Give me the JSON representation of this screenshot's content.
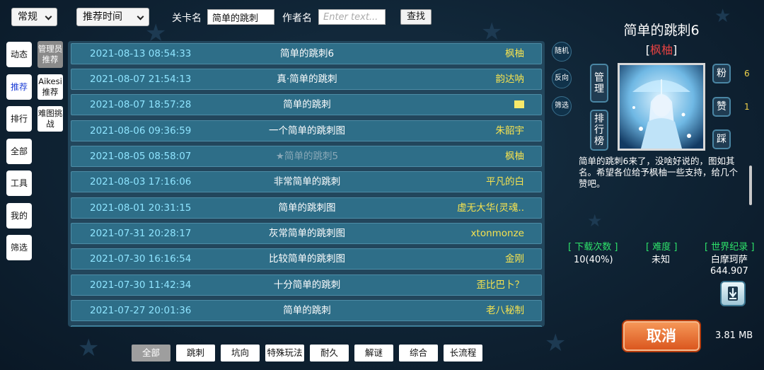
{
  "filters": {
    "mode": "常规",
    "sort": "推荐时间",
    "level_label": "关卡名",
    "level_value": "简单的跳刺",
    "author_label": "作者名",
    "author_placeholder": "Enter text...",
    "search_label": "查找"
  },
  "sidebar": {
    "primary": [
      "动态",
      "推荐",
      "排行",
      "全部",
      "工具",
      "我的",
      "筛选"
    ],
    "secondary": [
      "管理员推荐",
      "Aikesi推荐",
      "难图挑战"
    ]
  },
  "rows": [
    {
      "date": "2021-08-13 08:54:33",
      "name": "简单的跳刺6",
      "author": "枫柚"
    },
    {
      "date": "2021-08-07 21:54:13",
      "name": "真·简单的跳刺",
      "author": "韵达呐"
    },
    {
      "date": "2021-08-07 18:57:28",
      "name": "简单的跳刺",
      "author": ""
    },
    {
      "date": "2021-08-06 09:36:59",
      "name": "一个简单的跳刺图",
      "author": "朱韶宇"
    },
    {
      "date": "2021-08-05 08:58:07",
      "name": "★简单的跳刺5",
      "author": "枫柚"
    },
    {
      "date": "2021-08-03 17:16:06",
      "name": "非常简单的跳刺",
      "author": "平凡的白"
    },
    {
      "date": "2021-08-01 20:31:15",
      "name": "简单的跳刺图",
      "author": "虚无大华(灵魂.."
    },
    {
      "date": "2021-07-31 20:28:17",
      "name": "灰常简单的跳刺图",
      "author": "xtonmonze"
    },
    {
      "date": "2021-07-30 16:16:54",
      "name": "比较简单的跳刺图",
      "author": "金刚"
    },
    {
      "date": "2021-07-30 11:42:34",
      "name": "十分简单的跳刺",
      "author": "歪比巴卜？"
    },
    {
      "date": "2021-07-27 20:01:36",
      "name": "简单的跳刺",
      "author": "老八秘制"
    }
  ],
  "side_actions": [
    "随机",
    "反向",
    "筛选"
  ],
  "categories": [
    "全部",
    "跳刺",
    "坑向",
    "特殊玩法",
    "耐久",
    "解谜",
    "综合",
    "长流程"
  ],
  "detail": {
    "title": "简单的跳刺6",
    "author": "枫柚",
    "buttons": {
      "manage": "管理",
      "ranking": "排行榜",
      "fans": "粉",
      "like": "赞",
      "dislike": "踩"
    },
    "fans_count": "6",
    "like_count": "1",
    "description": "简单的跳刺6来了，没啥好说的，图如其名。希望各位给予枫柚一些支持，给几个赞吧。",
    "downloads_label": "[ 下载次数 ]",
    "downloads_value": "10(40%)",
    "difficulty_label": "[ 难度 ]",
    "difficulty_value": "未知",
    "record_label": "[ 世界纪录 ]",
    "record_holder": "白摩珂萨",
    "record_value": "644.907",
    "cancel_label": "取消",
    "file_size": "3.81 MB"
  },
  "colors": {
    "date": "#8ee4ff",
    "author": "#f7e34f",
    "meta_label": "#2ee36a",
    "cancel": "#e0642a",
    "author_highlight": "#e64242"
  },
  "icons": {
    "download": "download-icon",
    "thumbnail": "anime-girl-umbrella-thumbnail"
  }
}
